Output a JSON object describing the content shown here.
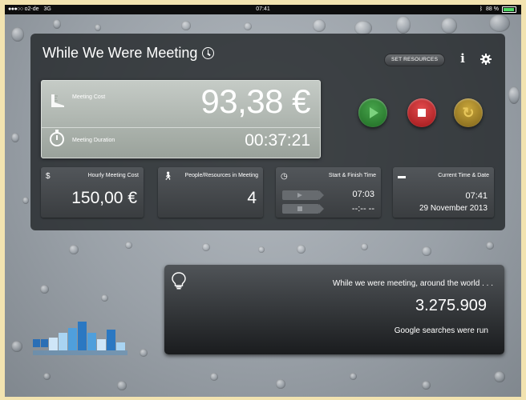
{
  "status_bar": {
    "carrier": "o2-de",
    "network": "3G",
    "time": "07:41",
    "battery": "88 %"
  },
  "app": {
    "title": "While We Were Meeting",
    "set_resources_label": "SET RESOURCES",
    "info_icon": "info-icon",
    "settings_icon": "gear-icon"
  },
  "cost_card": {
    "cost_label": "Meeting Cost",
    "cost_value": "93,38 €",
    "duration_label": "Meeting Duration",
    "duration_value": "00:37:21"
  },
  "controls": {
    "play_icon": "play-icon",
    "stop_icon": "stop-icon",
    "restart_icon": "restart-icon",
    "play_color": "#2e8a33",
    "stop_color": "#c2272a",
    "restart_color": "#a88a2c"
  },
  "cards": {
    "hourly": {
      "icon": "$",
      "title": "Hourly Meeting Cost",
      "value": "150,00 €"
    },
    "people": {
      "icon": "walking-person-icon",
      "title": "People/Resources in Meeting",
      "value": "4"
    },
    "start_finish": {
      "icon": "clock-icon",
      "title": "Start & Finish Time",
      "start": "07:03",
      "finish": "--:-- --"
    },
    "current": {
      "icon": "calendar-icon",
      "title": "Current Time & Date",
      "time": "07:41",
      "date": "29 November 2013"
    }
  },
  "world": {
    "intro": "While we were meeting, around the world . . .",
    "value": "3.275.909",
    "caption": "Google searches were run"
  }
}
